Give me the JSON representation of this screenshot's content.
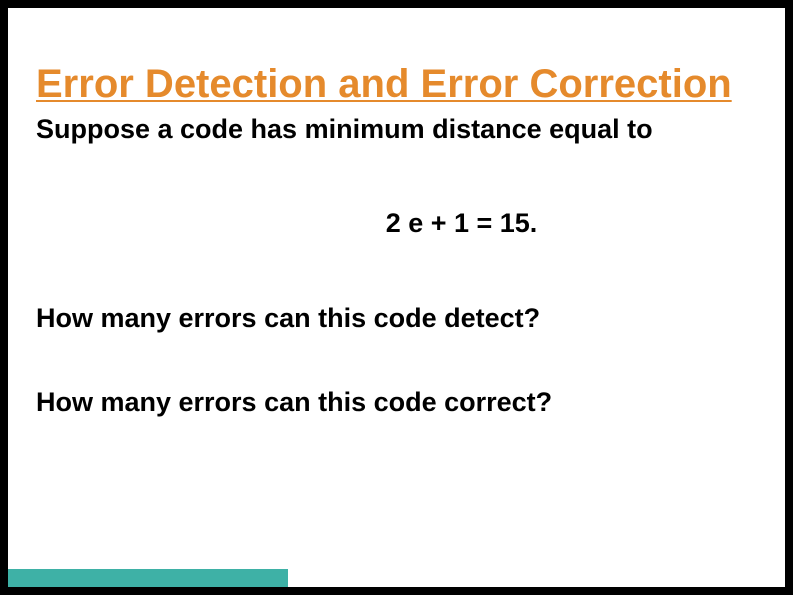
{
  "title": "Error Detection and Error Correction",
  "p1": "Suppose a code has minimum distance equal to",
  "equation": "2 e + 1 = 15.",
  "p2": "How many errors can this code detect?",
  "p3": "How many errors can this code correct?",
  "accent_color": "#3eb1a6",
  "title_color": "#e58a2c"
}
